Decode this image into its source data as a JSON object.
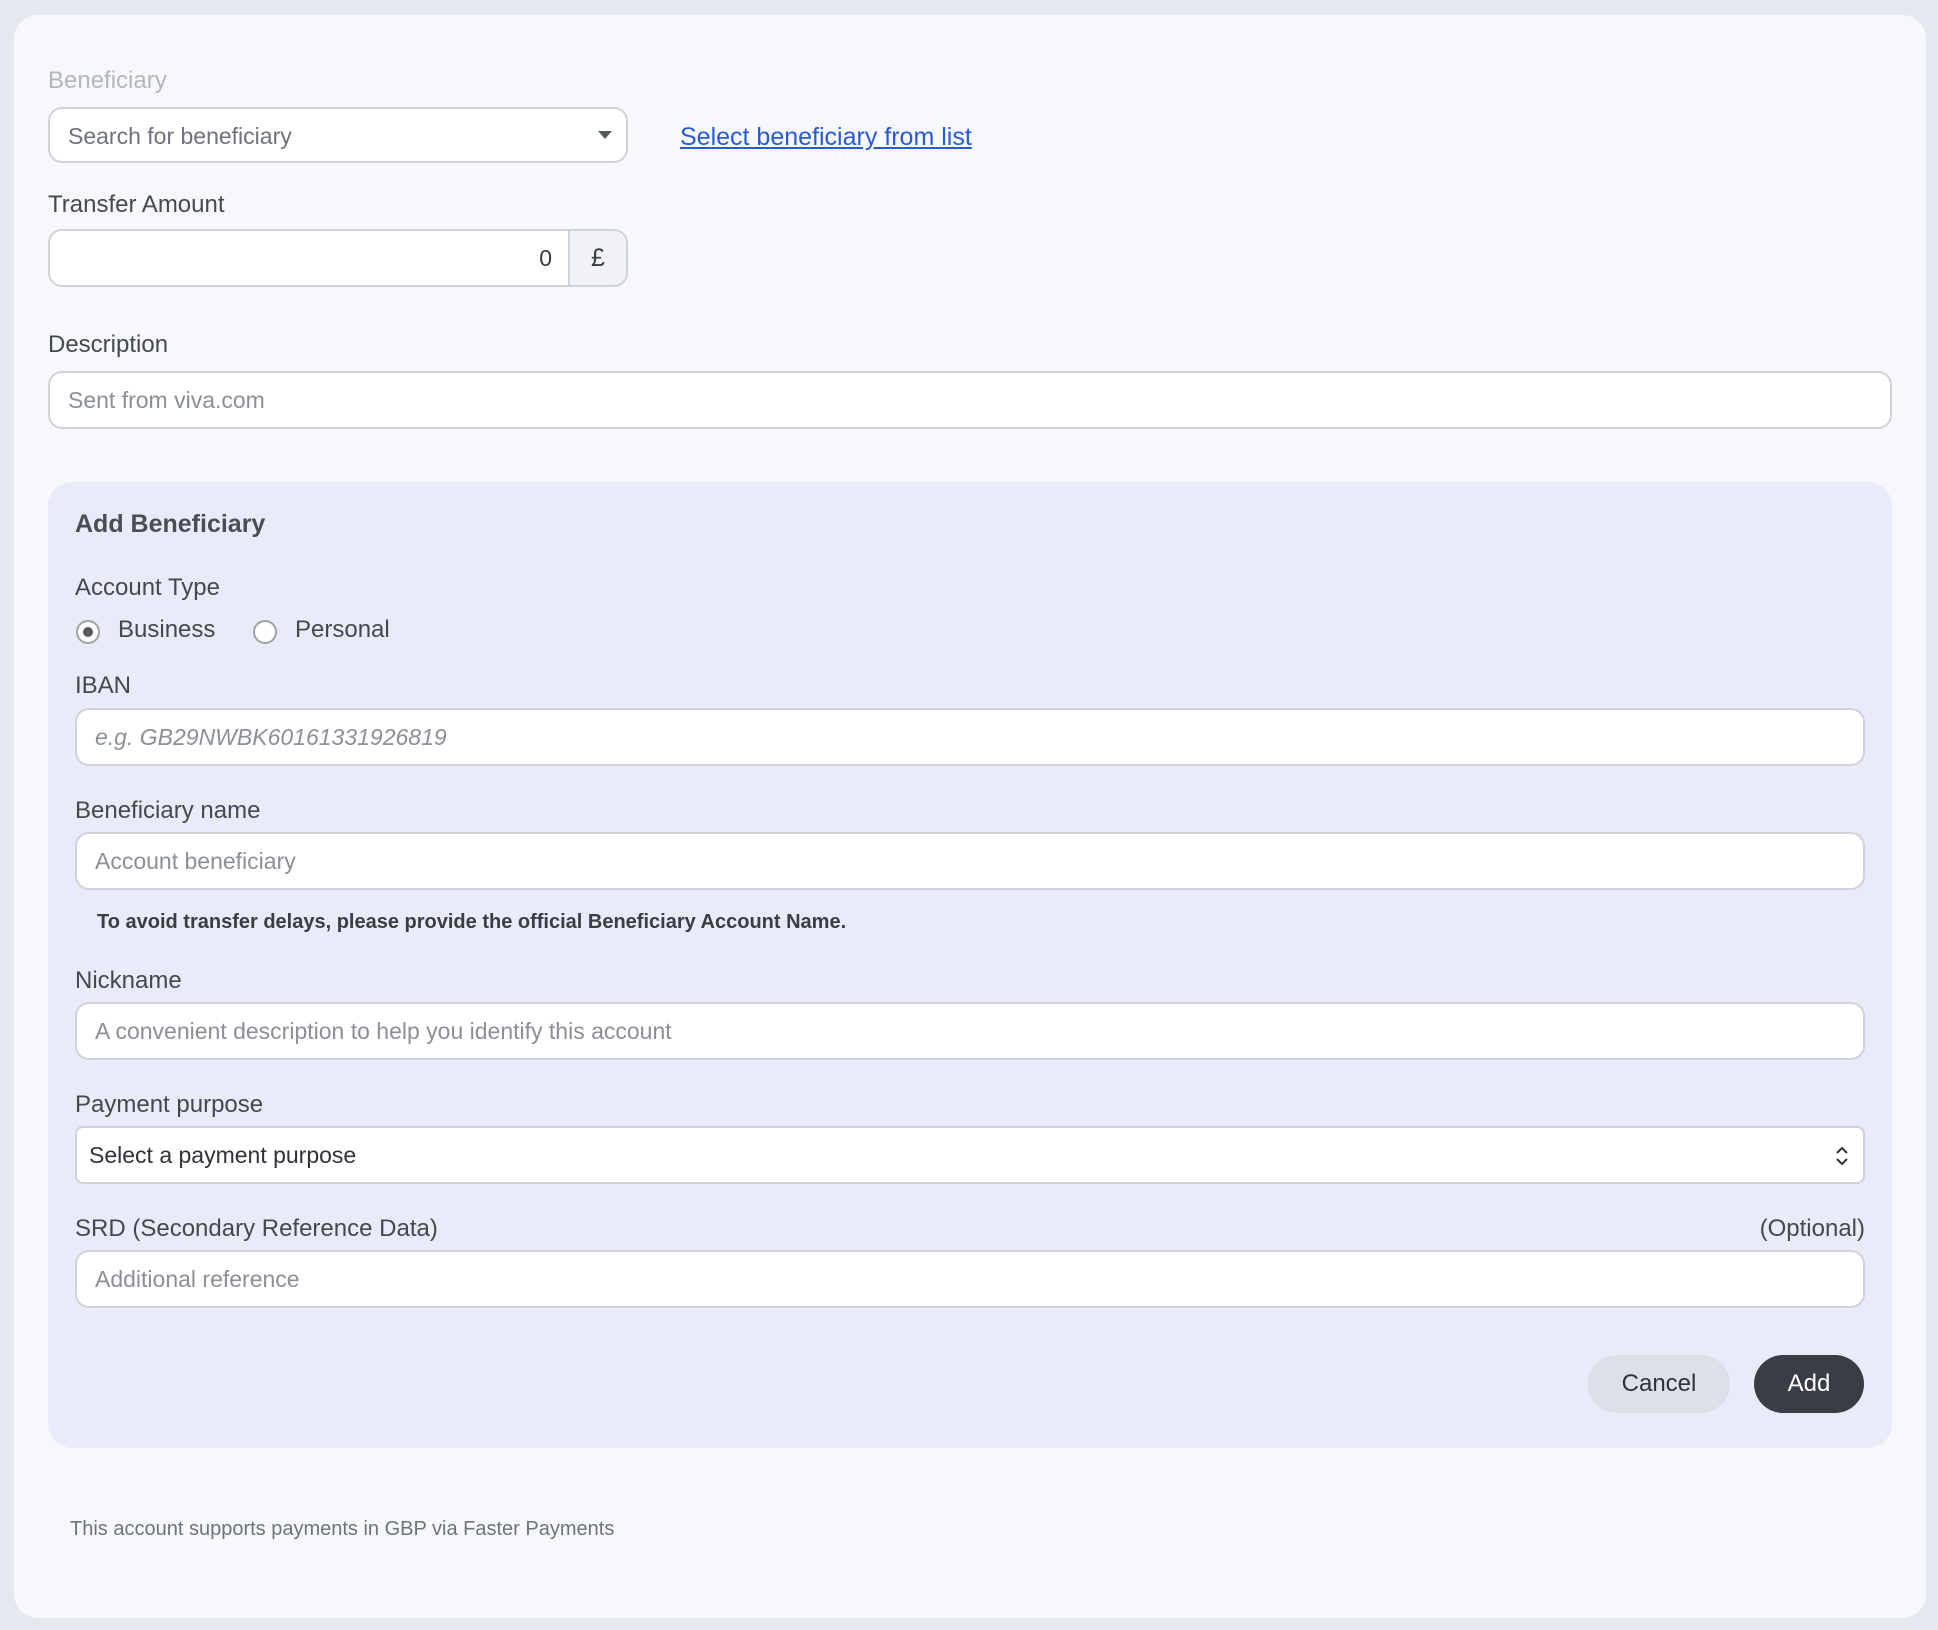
{
  "beneficiary": {
    "label": "Beneficiary",
    "search_placeholder": "Search for beneficiary",
    "select_from_list_link": "Select beneficiary from list"
  },
  "transfer_amount": {
    "label": "Transfer Amount",
    "value": "0",
    "currency_symbol": "£"
  },
  "description": {
    "label": "Description",
    "placeholder": "Sent from viva.com"
  },
  "add_beneficiary": {
    "title": "Add Beneficiary",
    "account_type": {
      "label": "Account Type",
      "options": [
        {
          "label": "Business",
          "selected": true
        },
        {
          "label": "Personal",
          "selected": false
        }
      ]
    },
    "iban": {
      "label": "IBAN",
      "placeholder": "e.g. GB29NWBK60161331926819"
    },
    "beneficiary_name": {
      "label": "Beneficiary name",
      "placeholder": "Account beneficiary",
      "helper": "To avoid transfer delays, please provide the official Beneficiary Account Name."
    },
    "nickname": {
      "label": "Nickname",
      "placeholder": "A convenient description to help you identify this account"
    },
    "payment_purpose": {
      "label": "Payment purpose",
      "selected": "Select a payment purpose"
    },
    "srd": {
      "label": "SRD (Secondary Reference Data)",
      "optional": "(Optional)",
      "placeholder": "Additional reference"
    },
    "cancel_label": "Cancel",
    "add_label": "Add"
  },
  "footer_note": "This account supports payments in GBP via Faster Payments",
  "colors": {
    "link": "#2a59d6",
    "panel_bg": "#e9ecf8",
    "primary_button": "#3a3d45"
  }
}
